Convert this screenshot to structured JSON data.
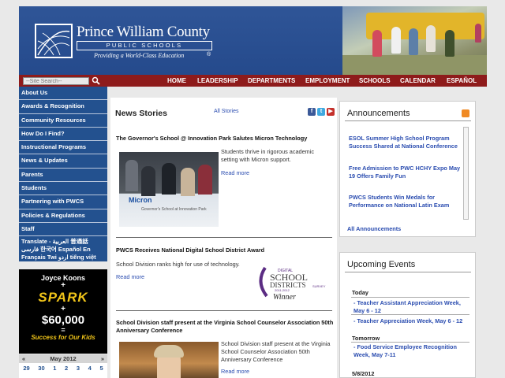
{
  "header": {
    "title": "Prince William County",
    "subtitle": "PUBLIC SCHOOLS",
    "tagline": "Providing a World-Class Education",
    "reg_mark": "®"
  },
  "nav": {
    "search_placeholder": "--Site Search--",
    "items": [
      "HOME",
      "LEADERSHIP",
      "DEPARTMENTS",
      "EMPLOYMENT",
      "SCHOOLS",
      "CALENDAR",
      "ESPAÑOL"
    ]
  },
  "sidebar": {
    "items": [
      "About Us",
      "Awards & Recognition",
      "Community Resources",
      "How Do I Find?",
      "Instructional Programs",
      "News & Updates",
      "Parents",
      "Students",
      "Partnering with PWCS",
      "Policies & Regulations",
      "Staff"
    ],
    "translate": "Translate - العربية 普通話 فارسی 한국어 Español En Français Twi اردو tiếng việt"
  },
  "promo": {
    "line1": "Joyce Koons",
    "plus1": "+",
    "word": "SPARK",
    "plus2": "+",
    "amount": "$60,000",
    "eq": "=",
    "tagline": "Success for Our Kids"
  },
  "calendar": {
    "prev": "«",
    "month": "May 2012",
    "next": "»",
    "days": [
      "29",
      "30",
      "1",
      "2",
      "3",
      "4",
      "5"
    ]
  },
  "news": {
    "title": "News Stories",
    "all_link": "All Stories",
    "stories": [
      {
        "headline": "The Governor's School @ Innovation Park Salutes Micron Technology",
        "text": "Students thrive in rigorous academic setting with Micron support.",
        "more": "Read more"
      },
      {
        "headline": "PWCS Receives National Digital School District Award",
        "text": "School Division ranks high for use of technology.",
        "more": "Read more"
      },
      {
        "headline": "School Division staff present at the Virginia School Counselor Association 50th Anniversary Conference",
        "text": "School Division staff present at the Virginia School Counselor Association 50th Anniversary Conference",
        "more": "Read more"
      }
    ],
    "img1_caption": "Micron",
    "img1_sub": "Governor's School at Innovation Park",
    "award_logo": {
      "top": "DIGITAL",
      "school": "SCHOOL",
      "districts": "DISTRICTS",
      "survey": "SURVEY",
      "years": "2011-2012",
      "winner": "Winner"
    }
  },
  "announcements": {
    "title": "Announcements",
    "items": [
      "ESOL Summer High School Program Success Shared at National Conference",
      "Free Admission to PWC HCHY Expo May 19 Offers Family Fun",
      "PWCS Students Win Medals for Performance on National Latin Exam"
    ],
    "all_link": "All Announcements"
  },
  "events": {
    "title": "Upcoming Events",
    "groups": [
      {
        "day": "Today",
        "items": [
          "- Teacher Assistant Appreciation Week, May 6 - 12",
          "- Teacher Appreciation Week, May 6 - 12"
        ]
      },
      {
        "day": "Tomorrow",
        "items": [
          "- Food Service Employee Recognition Week, May 7-11"
        ]
      },
      {
        "day": "5/8/2012",
        "items": []
      }
    ]
  },
  "colors": {
    "header_blue": "#2f5597",
    "nav_red": "#8e1b1b",
    "sidebar_blue": "#23518f",
    "link_blue": "#2b4db0"
  }
}
